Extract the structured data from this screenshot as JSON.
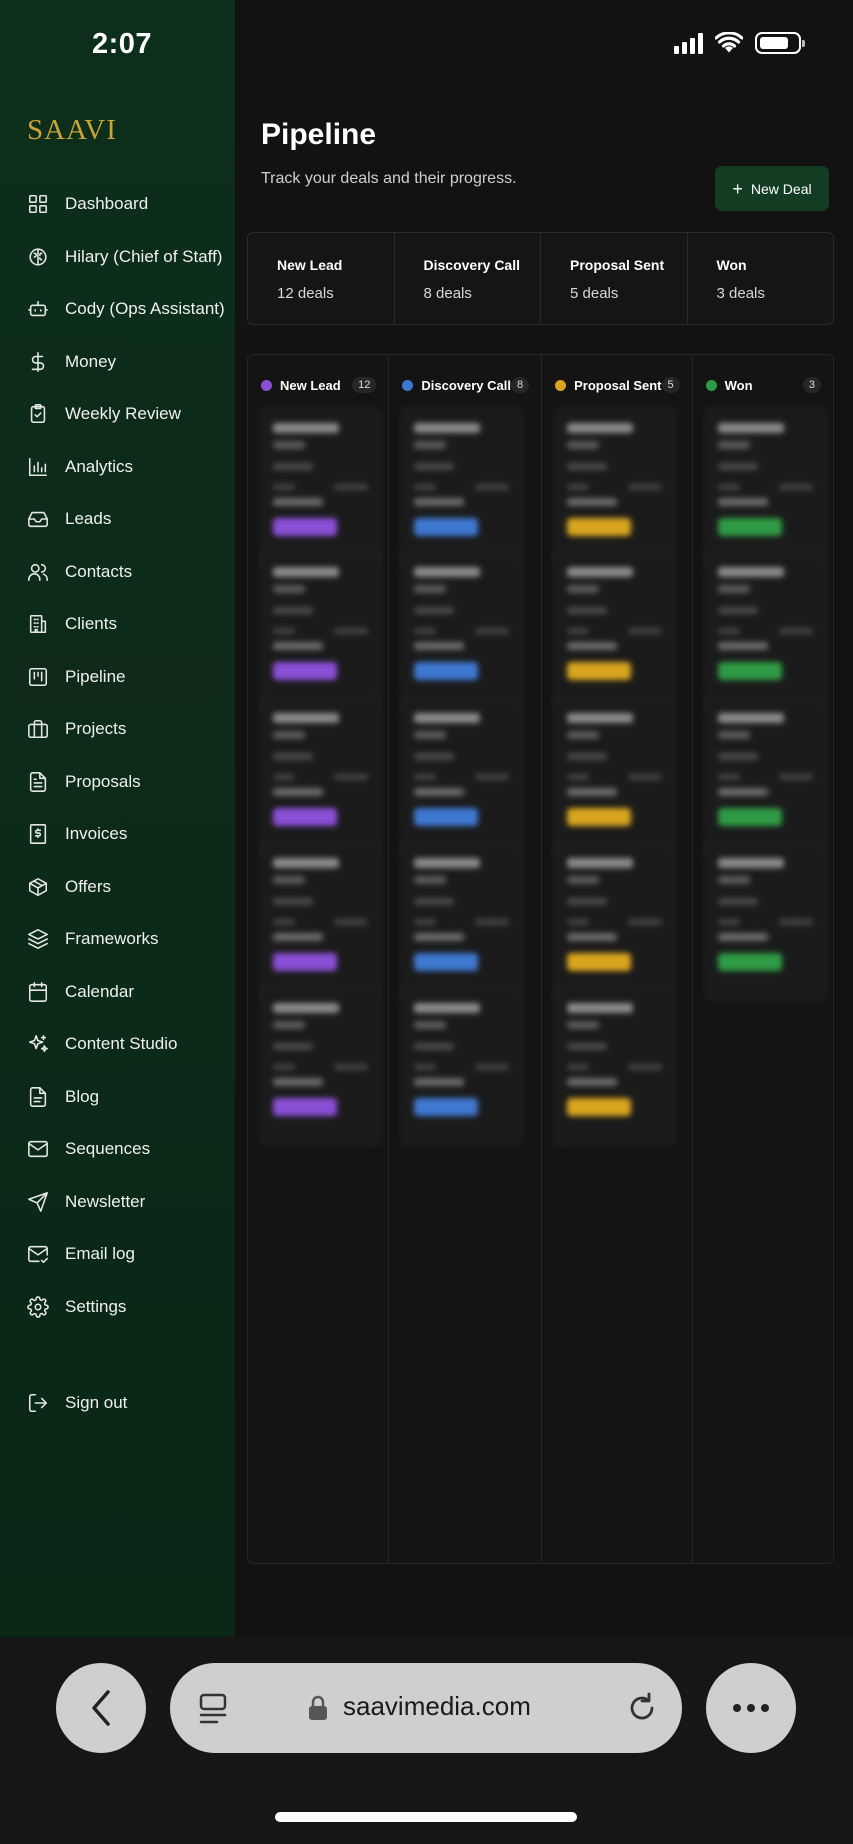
{
  "status": {
    "time": "2:07"
  },
  "brand": {
    "logo": "SAAVI",
    "accent": "#c9a23a"
  },
  "sidebar": {
    "items": [
      {
        "label": "Dashboard",
        "icon": "grid-icon"
      },
      {
        "label": "Hilary (Chief of Staff)",
        "icon": "brain-icon"
      },
      {
        "label": "Cody (Ops Assistant)",
        "icon": "bot-icon"
      },
      {
        "label": "Money",
        "icon": "dollar-icon"
      },
      {
        "label": "Weekly Review",
        "icon": "clipboard-check-icon"
      },
      {
        "label": "Analytics",
        "icon": "bar-chart-icon"
      },
      {
        "label": "Leads",
        "icon": "inbox-icon"
      },
      {
        "label": "Contacts",
        "icon": "users-icon"
      },
      {
        "label": "Clients",
        "icon": "building-icon"
      },
      {
        "label": "Pipeline",
        "icon": "kanban-icon",
        "active": true
      },
      {
        "label": "Projects",
        "icon": "briefcase-icon"
      },
      {
        "label": "Proposals",
        "icon": "file-text-icon"
      },
      {
        "label": "Invoices",
        "icon": "receipt-icon"
      },
      {
        "label": "Offers",
        "icon": "package-icon"
      },
      {
        "label": "Frameworks",
        "icon": "layers-icon"
      },
      {
        "label": "Calendar",
        "icon": "calendar-icon"
      },
      {
        "label": "Content Studio",
        "icon": "sparkles-icon"
      },
      {
        "label": "Blog",
        "icon": "document-icon"
      },
      {
        "label": "Sequences",
        "icon": "mail-icon"
      },
      {
        "label": "Newsletter",
        "icon": "send-icon"
      },
      {
        "label": "Email log",
        "icon": "mail-check-icon"
      },
      {
        "label": "Settings",
        "icon": "gear-icon"
      }
    ],
    "signout": {
      "label": "Sign out",
      "icon": "logout-icon"
    }
  },
  "main": {
    "title": "Pipeline",
    "subtitle": "Track your deals and their progress.",
    "new_deal_label": "New Deal",
    "summary": [
      {
        "name": "New Lead",
        "count": "12 deals"
      },
      {
        "name": "Discovery Call",
        "count": "8 deals"
      },
      {
        "name": "Proposal Sent",
        "count": "5 deals"
      },
      {
        "name": "Won",
        "count": "3 deals"
      }
    ],
    "columns": [
      {
        "name": "New Lead",
        "count": "12",
        "color": "#8a4fd6",
        "cards": 5
      },
      {
        "name": "Discovery Call",
        "count": "8",
        "color": "#3f78d0",
        "cards": 5
      },
      {
        "name": "Proposal Sent",
        "count": "5",
        "color": "#d9a51f",
        "cards": 5
      },
      {
        "name": "Won",
        "count": "3",
        "color": "#2f9a45",
        "cards": 4
      }
    ]
  },
  "browser": {
    "url": "saavimedia.com"
  }
}
